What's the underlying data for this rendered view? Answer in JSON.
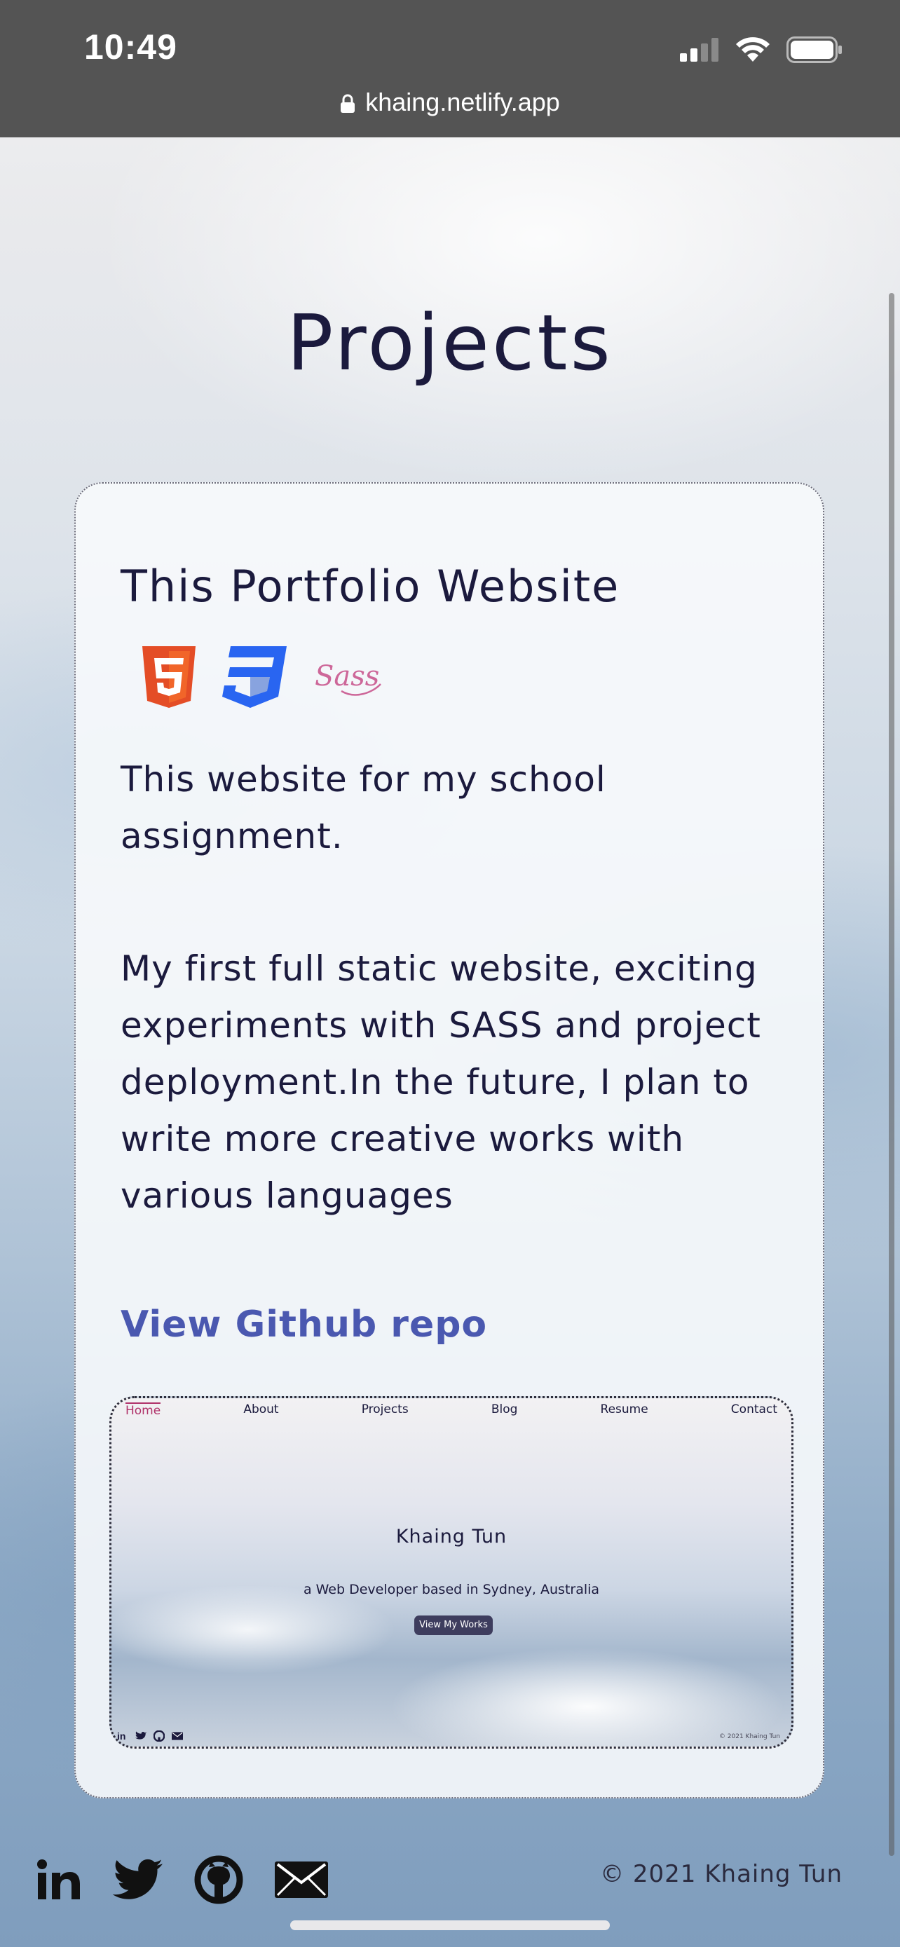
{
  "status_bar": {
    "time": "10:49"
  },
  "browser": {
    "url": "khaing.netlify.app"
  },
  "page": {
    "title": "Projects"
  },
  "project": {
    "title": "This Portfolio Website",
    "tech_icons": [
      "html5-icon",
      "css3-icon",
      "sass-icon"
    ],
    "description_1": "This website for my school assignment.",
    "description_2": "My first full static website, exciting experiments with SASS and project deployment.In the future, I plan to write more creative works with various languages",
    "repo_link": "View Github repo"
  },
  "preview": {
    "nav": [
      "Home",
      "About",
      "Projects",
      "Blog",
      "Resume",
      "Contact"
    ],
    "name": "Khaing Tun",
    "tagline": "a Web Developer based in Sydney, Australia",
    "button": "View My Works",
    "copyright": "© 2021 Khaing Tun"
  },
  "footer": {
    "social": [
      "linkedin-icon",
      "twitter-icon",
      "github-icon",
      "email-icon"
    ],
    "copyright": "© 2021 Khaing Tun"
  },
  "colors": {
    "title": "#1b1a3d",
    "link": "#4a58b0",
    "status_bar_bg": "#545454",
    "nav_active": "#b0326a"
  }
}
